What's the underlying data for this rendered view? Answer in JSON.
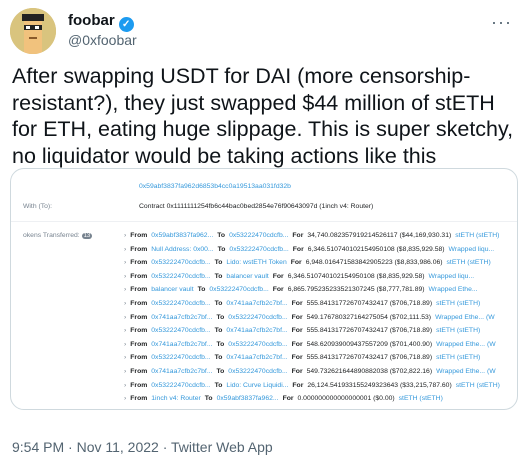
{
  "author": {
    "name": "foobar",
    "handle": "@0xfoobar",
    "verified_glyph": "✓"
  },
  "more_glyph": "···",
  "tweet_text": "After swapping USDT for DAI (more censorship-resistant?), they just swapped $44 million of stETH for ETH, eating huge slippage. This is super sketchy, no liquidator would be taking actions like this",
  "card": {
    "tx_hash": "0x59abf3837fa962d6853b4cc0a19513aa031fd32b",
    "interacted_label": "With (To):",
    "contract_line": "Contract 0x1111111254fb6c44bac0bed2854e76f90643097d (1inch v4: Router)",
    "tokens_label": "okens Transferred:",
    "tokens_count": "13",
    "rows": [
      {
        "from_lbl": "From",
        "from": "0x59abf3837fa962...",
        "to_lbl": "To",
        "to": "0x53222470cdcfb...",
        "for_lbl": "For",
        "amount": "34,740.082357919214526117 ($44,169,930.31)",
        "token": "stETH (stETH)"
      },
      {
        "from_lbl": "From",
        "from": "Null Address: 0x00...",
        "to_lbl": "To",
        "to": "0x53222470cdcfb...",
        "for_lbl": "For",
        "amount": "6,346.510740102154950108 ($8,835,929.58)",
        "token": "Wrapped liqu..."
      },
      {
        "from_lbl": "From",
        "from": "0x53222470cdcfb...",
        "to_lbl": "To",
        "to": "Lido: wstETH Token",
        "for_lbl": "For",
        "amount": "6,948.016471583842905223 ($8,833,986.06)",
        "token": "stETH (stETH)"
      },
      {
        "from_lbl": "From",
        "from": "0x53222470cdcfb...",
        "to_lbl": "To",
        "to": "balancer vault",
        "for_lbl": "For",
        "amount": "6,346.510740102154950108 ($8,835,929.58)",
        "token": "Wrapped liqu..."
      },
      {
        "from_lbl": "From",
        "from": "balancer vault",
        "to_lbl": "To",
        "to": "0x53222470cdcfb...",
        "for_lbl": "For",
        "amount": "6,865.795235233521307245 ($8,777,781.89)",
        "token": "Wrapped Ethe..."
      },
      {
        "from_lbl": "From",
        "from": "0x53222470cdcfb...",
        "to_lbl": "To",
        "to": "0x741aa7cfb2c7bf...",
        "for_lbl": "For",
        "amount": "555.841317726707432417 ($706,718.89)",
        "token": "stETH (stETH)"
      },
      {
        "from_lbl": "From",
        "from": "0x741aa7cfb2c7bf...",
        "to_lbl": "To",
        "to": "0x53222470cdcfb...",
        "for_lbl": "For",
        "amount": "549.176780327164275054 ($702,111.53)",
        "token": "Wrapped Ethe... (W"
      },
      {
        "from_lbl": "From",
        "from": "0x53222470cdcfb...",
        "to_lbl": "To",
        "to": "0x741aa7cfb2c7bf...",
        "for_lbl": "For",
        "amount": "555.841317726707432417 ($706,718.89)",
        "token": "stETH (stETH)"
      },
      {
        "from_lbl": "From",
        "from": "0x741aa7cfb2c7bf...",
        "to_lbl": "To",
        "to": "0x53222470cdcfb...",
        "for_lbl": "For",
        "amount": "548.620939009437557209 ($701,400.90)",
        "token": "Wrapped Ethe... (W"
      },
      {
        "from_lbl": "From",
        "from": "0x53222470cdcfb...",
        "to_lbl": "To",
        "to": "0x741aa7cfb2c7bf...",
        "for_lbl": "For",
        "amount": "555.841317726707432417 ($706,718.89)",
        "token": "stETH (stETH)"
      },
      {
        "from_lbl": "From",
        "from": "0x741aa7cfb2c7bf...",
        "to_lbl": "To",
        "to": "0x53222470cdcfb...",
        "for_lbl": "For",
        "amount": "549.732621644890882038 ($702,822.16)",
        "token": "Wrapped Ethe... (W"
      },
      {
        "from_lbl": "From",
        "from": "0x53222470cdcfb...",
        "to_lbl": "To",
        "to": "Lido: Curve Liquidi...",
        "for_lbl": "For",
        "amount": "26,124.541933155249323643 ($33,215,787.60)",
        "token": "stETH (stETH)"
      },
      {
        "from_lbl": "From",
        "from": "1inch v4: Router",
        "to_lbl": "To",
        "to": "0x59abf3837fa962...",
        "for_lbl": "For",
        "amount": "0.000000000000000001 ($0.00)",
        "token": "stETH (stETH)"
      }
    ]
  },
  "footer": "9:54 PM · Nov 11, 2022 · Twitter Web App"
}
